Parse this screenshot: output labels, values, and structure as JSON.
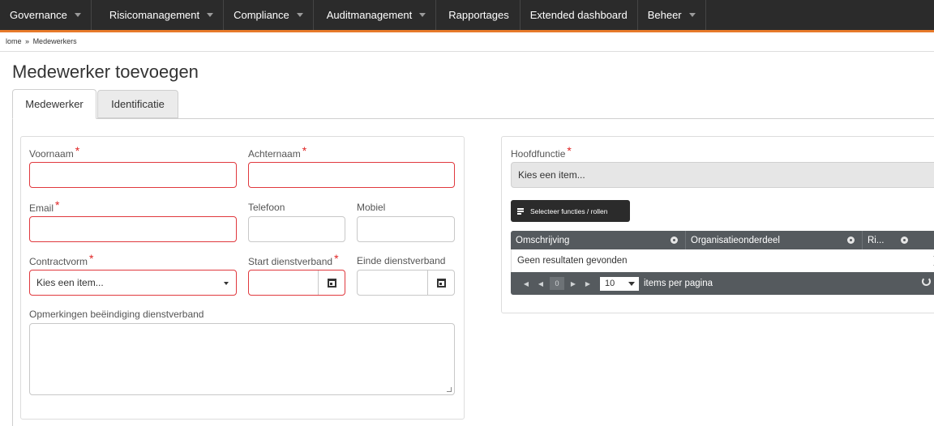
{
  "topnav": {
    "items": [
      {
        "label": "Governance",
        "dropdown": true
      },
      {
        "label": "Risicomanagement",
        "dropdown": true
      },
      {
        "label": "Compliance",
        "dropdown": true
      },
      {
        "label": "Auditmanagement",
        "dropdown": true
      },
      {
        "label": "Rapportages",
        "dropdown": false
      },
      {
        "label": "Extended dashboard",
        "dropdown": false
      },
      {
        "label": "Beheer",
        "dropdown": true
      }
    ],
    "accent_color": "#e77a2a"
  },
  "breadcrumb": {
    "home": "lome",
    "separator": "»",
    "current": "Medewerkers"
  },
  "page": {
    "title": "Medewerker toevoegen"
  },
  "tabs": [
    {
      "label": "Medewerker",
      "active": true
    },
    {
      "label": "Identificatie",
      "active": false
    }
  ],
  "form": {
    "voornaam": {
      "label": "Voornaam",
      "required_mark": "*",
      "value": ""
    },
    "achternaam": {
      "label": "Achternaam",
      "required_mark": "*",
      "value": ""
    },
    "email": {
      "label": "Email",
      "required_mark": "*",
      "value": ""
    },
    "telefoon": {
      "label": "Telefoon",
      "value": ""
    },
    "mobiel": {
      "label": "Mobiel",
      "value": ""
    },
    "contractvorm": {
      "label": "Contractvorm",
      "required_mark": "*",
      "value": "Kies een item..."
    },
    "start_dienstverband": {
      "label": "Start dienstverband",
      "required_mark": "*",
      "value": ""
    },
    "einde_dienstverband": {
      "label": "Einde dienstverband",
      "value": ""
    },
    "opmerkingen": {
      "label": "Opmerkingen beëindiging dienstverband",
      "value": ""
    }
  },
  "functions": {
    "hoofdfunctie": {
      "label": "Hoofdfunctie",
      "required_mark": "*",
      "value": "Kies een item..."
    },
    "select_button_label": "Selecteer functies / rollen",
    "grid": {
      "columns": [
        "Omschrijving",
        "Organisatieonderdeel",
        "Ri..."
      ],
      "empty_text": "Geen resultaten gevonden",
      "pager": {
        "current_page": "0",
        "page_size": "10",
        "items_per_page_label": "items per pagina"
      }
    }
  },
  "error_color": "#e0393e"
}
